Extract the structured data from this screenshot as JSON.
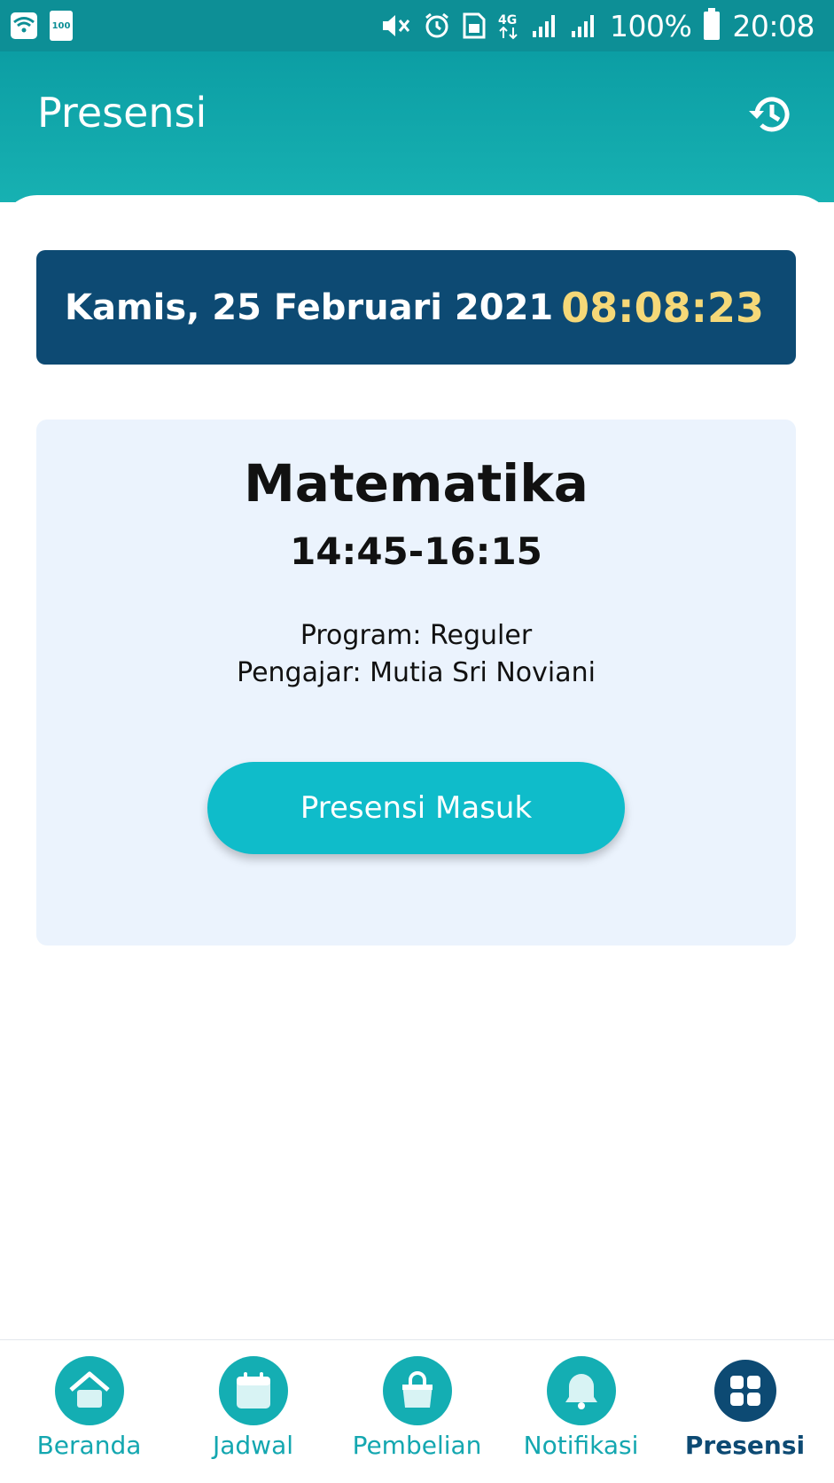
{
  "status_bar": {
    "battery_small_label": "100",
    "icons": [
      "wifi-icon",
      "battery-saver-icon",
      "mute-icon",
      "alarm-icon",
      "sim-icon",
      "4g-icon",
      "signal-icon",
      "signal-icon",
      "battery-icon"
    ],
    "network": "4G",
    "battery_percent": "100%",
    "time": "20:08"
  },
  "header": {
    "title": "Presensi",
    "history_icon": "history-icon"
  },
  "date_banner": {
    "date": "Kamis, 25 Februari 2021",
    "clock": "08:08:23"
  },
  "class_card": {
    "subject": "Matematika",
    "time_range": "14:45-16:15",
    "program": "Program: Reguler",
    "teacher": "Pengajar: Mutia Sri Noviani",
    "button_label": "Presensi Masuk"
  },
  "bottom_nav": {
    "items": [
      {
        "label": "Beranda",
        "icon": "home-icon",
        "active": false
      },
      {
        "label": "Jadwal",
        "icon": "calendar-icon",
        "active": false
      },
      {
        "label": "Pembelian",
        "icon": "shopping-bag-icon",
        "active": false
      },
      {
        "label": "Notifikasi",
        "icon": "bell-icon",
        "active": false
      },
      {
        "label": "Presensi",
        "icon": "grid-icon",
        "active": true
      }
    ]
  },
  "colors": {
    "header_teal": "#0c9ea4",
    "banner_navy": "#0d4a73",
    "clock_yellow": "#f5d878",
    "card_bg": "#ebf3fd",
    "button_teal": "#0fbcca"
  }
}
